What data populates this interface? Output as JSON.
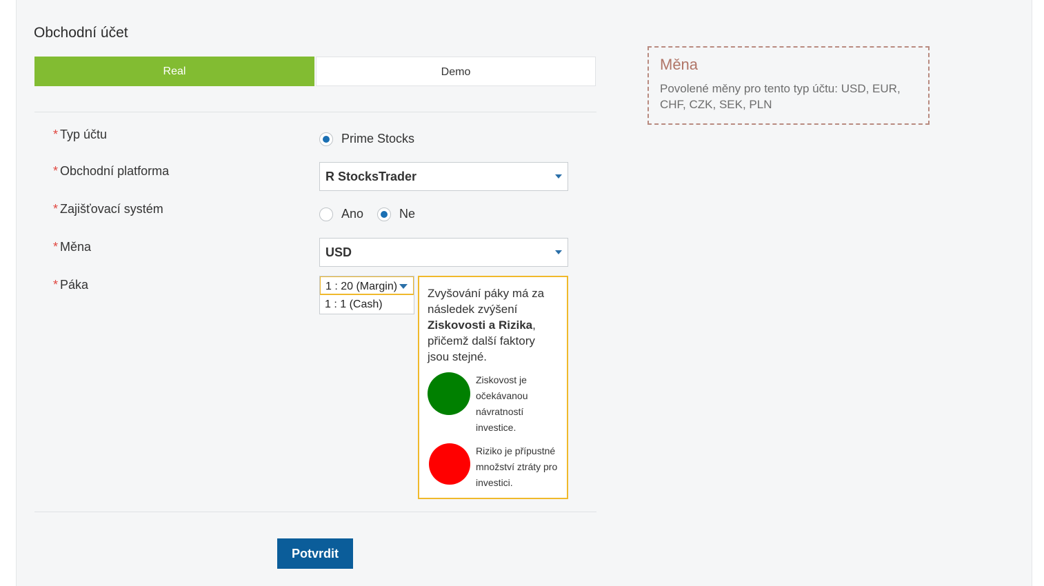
{
  "page_title": "Obchodní účet",
  "tabs": [
    {
      "label": "Real",
      "active": true
    },
    {
      "label": "Demo",
      "active": false
    }
  ],
  "form": {
    "required_mark": "*",
    "account_type": {
      "label": "Typ účtu",
      "option": "Prime Stocks",
      "checked": true
    },
    "platform": {
      "label": "Obchodní platforma",
      "value": "R StocksTrader"
    },
    "hedging": {
      "label": "Zajišťovací systém",
      "options": [
        {
          "label": "Ano",
          "checked": false
        },
        {
          "label": "Ne",
          "checked": true
        }
      ]
    },
    "currency": {
      "label": "Měna",
      "value": "USD"
    },
    "leverage": {
      "label": "Páka",
      "options": [
        {
          "label": "1 : 20 (Margin)",
          "selected": true
        },
        {
          "label": "1 : 1 (Cash)",
          "selected": false
        }
      ]
    }
  },
  "leverage_info": {
    "text_before": "Zvyšování páky má za následek zvýšení ",
    "text_bold": "Ziskovosti a Rizika",
    "text_after": ", přičemž další faktory jsou stejné.",
    "profit": {
      "color": "#008000",
      "text": "Ziskovost je očekávanou návratností investice."
    },
    "risk": {
      "color": "#ff0000",
      "text": "Riziko je přípustné množství ztráty pro investici."
    }
  },
  "submit_label": "Potvrdit",
  "currency_note": {
    "title": "Měna",
    "text": "Povolené měny pro tento typ účtu: USD, EUR, CHF, CZK, SEK, PLN"
  },
  "colors": {
    "accent_green": "#82bc32",
    "button_blue": "#0b5d9a",
    "radio_blue": "#1a6fb3",
    "warning_border": "#f0b92b",
    "required_red": "#e0463f"
  }
}
